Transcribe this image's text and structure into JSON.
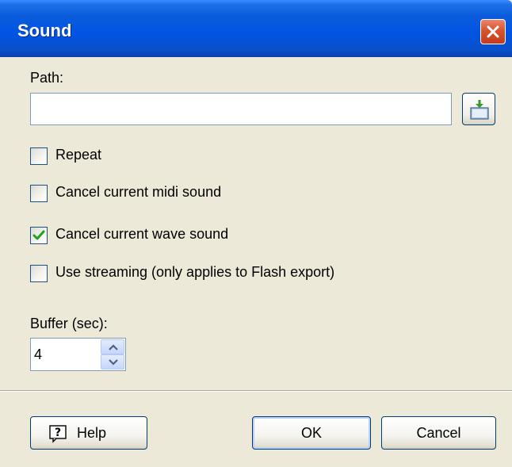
{
  "window": {
    "title": "Sound"
  },
  "path": {
    "label": "Path:",
    "value": "",
    "browse_icon": "folder-open-icon"
  },
  "options": [
    {
      "label": "Repeat",
      "checked": false
    },
    {
      "label": "Cancel current midi sound",
      "checked": false
    },
    {
      "label": "Cancel current wave sound",
      "checked": true
    },
    {
      "label": "Use streaming (only applies to Flash export)",
      "checked": false
    }
  ],
  "buffer": {
    "label": "Buffer (sec):",
    "value": "4"
  },
  "buttons": {
    "help": "Help",
    "ok": "OK",
    "cancel": "Cancel"
  },
  "colors": {
    "titlebar": "#0054e3",
    "close": "#d9532f",
    "check": "#21a121",
    "dialog_bg": "#ece9d8"
  }
}
